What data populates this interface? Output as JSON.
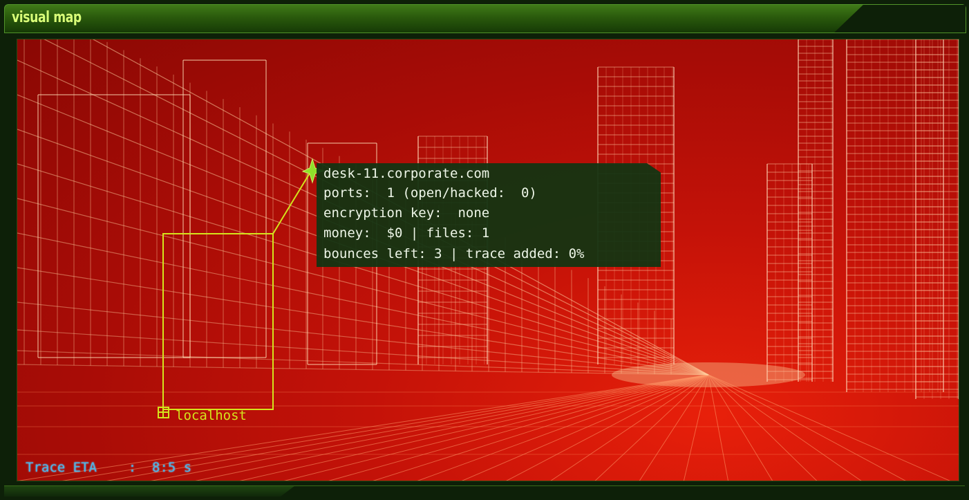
{
  "window": {
    "title": "visual map"
  },
  "colors": {
    "accent": "#d8ff78",
    "link_line": "#d4e41c",
    "trace_text": "#4ab4e8",
    "background_red": "#c41208"
  },
  "map": {
    "localhost_label": "localhost",
    "localhost_icon": "node-square-icon",
    "target_icon": "node-star-icon"
  },
  "node_popup": {
    "hostname": "desk-11.corporate.com",
    "ports": "ports:  1 (open/hacked:  0)",
    "encryption": "encryption key:  none",
    "money_files": "money:  $0 | files: 1",
    "bounces_trace": "bounces left: 3 | trace added: 0%"
  },
  "status": {
    "trace_eta": "Trace ETA    :  8:5 s"
  }
}
